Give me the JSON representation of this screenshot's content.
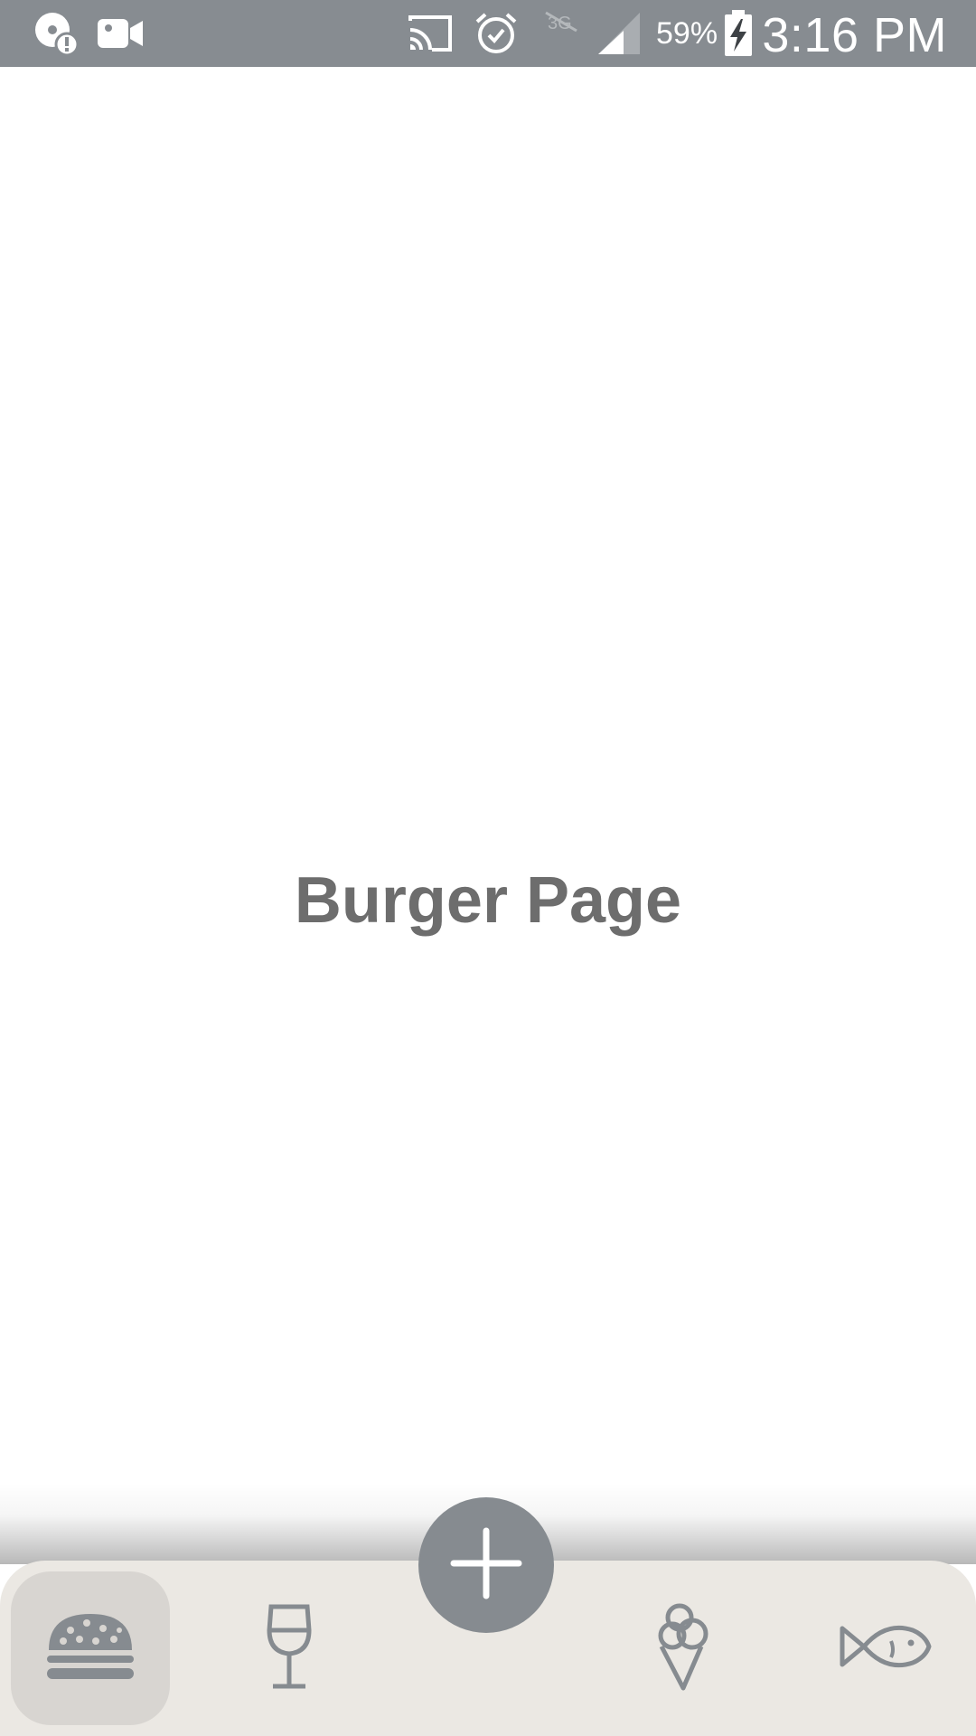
{
  "status_bar": {
    "battery_percent": "59%",
    "time": "3:16 PM",
    "icons": [
      "disc-alert-icon",
      "video-camera-icon",
      "cast-icon",
      "alarm-icon",
      "no-3g-icon",
      "signal-icon",
      "battery-charging-icon"
    ]
  },
  "page": {
    "title": "Burger Page"
  },
  "bottom_nav": {
    "items": [
      {
        "icon": "burger-icon",
        "active": true
      },
      {
        "icon": "wine-glass-icon",
        "active": false
      },
      {
        "icon": "ice-cream-icon",
        "active": false
      },
      {
        "icon": "fish-icon",
        "active": false
      }
    ],
    "fab_icon": "plus-icon"
  },
  "colors": {
    "status_bar": "#878c91",
    "nav_background": "#ebe8e3",
    "nav_active": "#d8d5d1",
    "fab": "#868b90",
    "icon": "#868b90",
    "title_text": "#6d6d6d"
  }
}
